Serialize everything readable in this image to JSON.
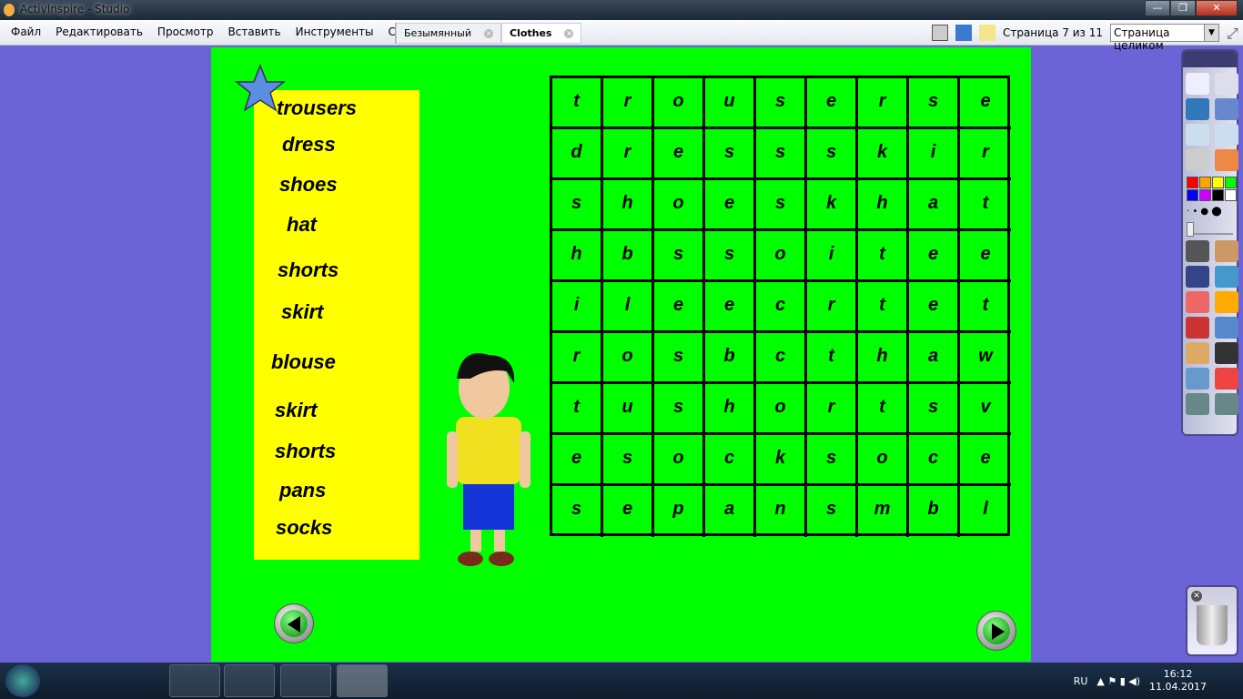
{
  "window": {
    "title": "ActivInspire - Studio",
    "min": "—",
    "restore": "❐",
    "close": "✕"
  },
  "menu": [
    "Файл",
    "Редактировать",
    "Просмотр",
    "Вставить",
    "Инструменты",
    "Справка"
  ],
  "tabs": [
    {
      "label": "Безымянный",
      "active": false
    },
    {
      "label": "Clothes",
      "active": true
    }
  ],
  "page_indicator": "Страница 7 из 11",
  "zoom_select": "Страница целиком",
  "words": [
    "trousers",
    "dress",
    "shoes",
    "hat",
    "shorts",
    "skirt",
    "blouse",
    "skirt",
    "shorts",
    "pans",
    "socks"
  ],
  "grid": [
    [
      "t",
      "r",
      "o",
      "u",
      "s",
      "e",
      "r",
      "s",
      "e"
    ],
    [
      "d",
      "r",
      "e",
      "s",
      "s",
      "s",
      "k",
      "i",
      "r"
    ],
    [
      "s",
      "h",
      "o",
      "e",
      "s",
      "k",
      "h",
      "a",
      "t"
    ],
    [
      "h",
      "b",
      "s",
      "s",
      "o",
      "i",
      "t",
      "e",
      "e"
    ],
    [
      "i",
      "l",
      "e",
      "e",
      "c",
      "r",
      "t",
      "e",
      "t"
    ],
    [
      "r",
      "o",
      "s",
      "b",
      "c",
      "t",
      "h",
      "a",
      "w"
    ],
    [
      "t",
      "u",
      "s",
      "h",
      "o",
      "r",
      "t",
      "s",
      "v"
    ],
    [
      "e",
      "s",
      "o",
      "c",
      "k",
      "s",
      "o",
      "c",
      "e"
    ],
    [
      "s",
      "e",
      "p",
      "a",
      "n",
      "s",
      "m",
      "b",
      "l"
    ]
  ],
  "palette": [
    "#ff0000",
    "#ffa500",
    "#ffff00",
    "#00ff00",
    "#0000ff",
    "#cc00ff",
    "#000000",
    "#ffffff"
  ],
  "colors": {
    "canvas": "#00ff00",
    "wordbox": "#ffff00",
    "background": "#6b63d6"
  },
  "taskbar": {
    "lang": "RU",
    "time": "16:12",
    "date": "11.04.2017"
  }
}
